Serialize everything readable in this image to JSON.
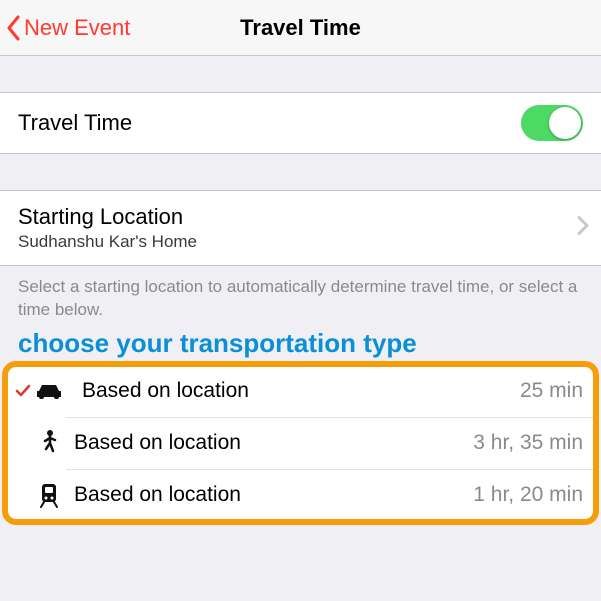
{
  "nav": {
    "back_label": "New Event",
    "title": "Travel Time"
  },
  "toggle": {
    "label": "Travel Time",
    "on": true
  },
  "starting": {
    "label": "Starting Location",
    "value": "Sudhanshu Kar's Home"
  },
  "hint": "Select a starting location to automatically determine travel time, or select a time below.",
  "annotation": "choose your transportation type",
  "options": [
    {
      "mode": "car",
      "label": "Based on location",
      "duration": "25 min",
      "selected": true
    },
    {
      "mode": "walk",
      "label": "Based on location",
      "duration": "3 hr, 35 min",
      "selected": false
    },
    {
      "mode": "transit",
      "label": "Based on location",
      "duration": "1 hr, 20 min",
      "selected": false
    }
  ]
}
